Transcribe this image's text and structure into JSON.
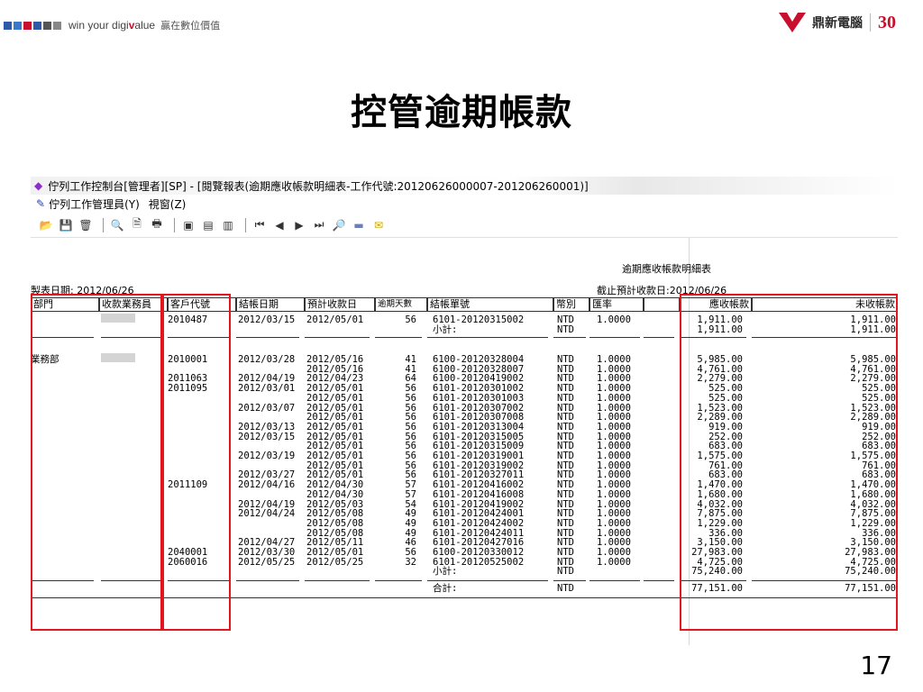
{
  "header": {
    "tagline": "win your digi",
    "tagline_v": "v",
    "tagline_end": "alue",
    "tagline_zh": "贏在數位價值",
    "brand_name": "鼎新電腦",
    "brand_30": "30",
    "colors": {
      "brand_red": "#c8102e",
      "squares": [
        "#2e5aa8",
        "#3a78c8",
        "#c8102e",
        "#2e5aa8",
        "#555555",
        "#888888"
      ]
    }
  },
  "slide_title": "控管逾期帳款",
  "app": {
    "title": "佇列工作控制台[管理者][SP] - [閱覽報表(逾期應收帳款明細表-工作代號:20120626000007-201206260001)]",
    "menu": [
      "佇列工作管理員(Y)",
      "視窗(Z)"
    ],
    "toolbar_icons": [
      "open-icon",
      "save-icon",
      "delete-icon",
      "find-icon",
      "preview-icon",
      "print-icon",
      "export-icon",
      "export-alt-icon",
      "copy-icon",
      "first-page-icon",
      "prev-page-icon",
      "next-page-icon",
      "last-page-icon",
      "zoom-icon",
      "separator-bar-icon",
      "mail-icon"
    ]
  },
  "report": {
    "name": "逾期應收帳款明細表",
    "print_date_label": "製表日期:",
    "print_date": "2012/06/26",
    "cutoff_label": "截止預計收款日:",
    "cutoff_date": "2012/06/26",
    "columns": [
      "部門",
      "收款業務員",
      "客戶代號",
      "結帳日期",
      "預計收款日",
      "逾期天數",
      "結帳單號",
      "幣別",
      "匯率",
      "",
      "應收帳款",
      "未收帳款"
    ],
    "group1": {
      "dept": "",
      "customer": "2010487",
      "rows": [
        {
          "close": "2012/03/15",
          "due": "2012/05/01",
          "days": "56",
          "doc": "6101-20120315002",
          "cur": "NTD",
          "rate": "1.0000",
          "ar": "1,911.00",
          "un": "1,911.00"
        }
      ],
      "subtotal": {
        "label": "小計:",
        "cur": "NTD",
        "ar": "1,911.00",
        "un": "1,911.00"
      }
    },
    "group2": {
      "dept": "業務部",
      "rows": [
        {
          "cust": "2010001",
          "close": "2012/03/28",
          "due": "2012/05/16",
          "days": "41",
          "doc": "6100-20120328004",
          "cur": "NTD",
          "rate": "1.0000",
          "ar": "5,985.00",
          "un": "5,985.00"
        },
        {
          "cust": "",
          "close": "",
          "due": "2012/05/16",
          "days": "41",
          "doc": "6100-20120328007",
          "cur": "NTD",
          "rate": "1.0000",
          "ar": "4,761.00",
          "un": "4,761.00"
        },
        {
          "cust": "2011063",
          "close": "2012/04/19",
          "due": "2012/04/23",
          "days": "64",
          "doc": "6100-20120419002",
          "cur": "NTD",
          "rate": "1.0000",
          "ar": "2,279.00",
          "un": "2,279.00"
        },
        {
          "cust": "2011095",
          "close": "2012/03/01",
          "due": "2012/05/01",
          "days": "56",
          "doc": "6101-20120301002",
          "cur": "NTD",
          "rate": "1.0000",
          "ar": "525.00",
          "un": "525.00"
        },
        {
          "cust": "",
          "close": "",
          "due": "2012/05/01",
          "days": "56",
          "doc": "6101-20120301003",
          "cur": "NTD",
          "rate": "1.0000",
          "ar": "525.00",
          "un": "525.00"
        },
        {
          "cust": "",
          "close": "2012/03/07",
          "due": "2012/05/01",
          "days": "56",
          "doc": "6101-20120307002",
          "cur": "NTD",
          "rate": "1.0000",
          "ar": "1,523.00",
          "un": "1,523.00"
        },
        {
          "cust": "",
          "close": "",
          "due": "2012/05/01",
          "days": "56",
          "doc": "6101-20120307008",
          "cur": "NTD",
          "rate": "1.0000",
          "ar": "2,289.00",
          "un": "2,289.00"
        },
        {
          "cust": "",
          "close": "2012/03/13",
          "due": "2012/05/01",
          "days": "56",
          "doc": "6101-20120313004",
          "cur": "NTD",
          "rate": "1.0000",
          "ar": "919.00",
          "un": "919.00"
        },
        {
          "cust": "",
          "close": "2012/03/15",
          "due": "2012/05/01",
          "days": "56",
          "doc": "6101-20120315005",
          "cur": "NTD",
          "rate": "1.0000",
          "ar": "252.00",
          "un": "252.00"
        },
        {
          "cust": "",
          "close": "",
          "due": "2012/05/01",
          "days": "56",
          "doc": "6101-20120315009",
          "cur": "NTD",
          "rate": "1.0000",
          "ar": "683.00",
          "un": "683.00"
        },
        {
          "cust": "",
          "close": "2012/03/19",
          "due": "2012/05/01",
          "days": "56",
          "doc": "6101-20120319001",
          "cur": "NTD",
          "rate": "1.0000",
          "ar": "1,575.00",
          "un": "1,575.00"
        },
        {
          "cust": "",
          "close": "",
          "due": "2012/05/01",
          "days": "56",
          "doc": "6101-20120319002",
          "cur": "NTD",
          "rate": "1.0000",
          "ar": "761.00",
          "un": "761.00"
        },
        {
          "cust": "",
          "close": "2012/03/27",
          "due": "2012/05/01",
          "days": "56",
          "doc": "6101-20120327011",
          "cur": "NTD",
          "rate": "1.0000",
          "ar": "683.00",
          "un": "683.00"
        },
        {
          "cust": "2011109",
          "close": "2012/04/16",
          "due": "2012/04/30",
          "days": "57",
          "doc": "6101-20120416002",
          "cur": "NTD",
          "rate": "1.0000",
          "ar": "1,470.00",
          "un": "1,470.00"
        },
        {
          "cust": "",
          "close": "",
          "due": "2012/04/30",
          "days": "57",
          "doc": "6101-20120416008",
          "cur": "NTD",
          "rate": "1.0000",
          "ar": "1,680.00",
          "un": "1,680.00"
        },
        {
          "cust": "",
          "close": "2012/04/19",
          "due": "2012/05/03",
          "days": "54",
          "doc": "6101-20120419002",
          "cur": "NTD",
          "rate": "1.0000",
          "ar": "4,032.00",
          "un": "4,032.00"
        },
        {
          "cust": "",
          "close": "2012/04/24",
          "due": "2012/05/08",
          "days": "49",
          "doc": "6101-20120424001",
          "cur": "NTD",
          "rate": "1.0000",
          "ar": "7,875.00",
          "un": "7,875.00"
        },
        {
          "cust": "",
          "close": "",
          "due": "2012/05/08",
          "days": "49",
          "doc": "6101-20120424002",
          "cur": "NTD",
          "rate": "1.0000",
          "ar": "1,229.00",
          "un": "1,229.00"
        },
        {
          "cust": "",
          "close": "",
          "due": "2012/05/08",
          "days": "49",
          "doc": "6101-20120424011",
          "cur": "NTD",
          "rate": "1.0000",
          "ar": "336.00",
          "un": "336.00"
        },
        {
          "cust": "",
          "close": "2012/04/27",
          "due": "2012/05/11",
          "days": "46",
          "doc": "6101-20120427016",
          "cur": "NTD",
          "rate": "1.0000",
          "ar": "3,150.00",
          "un": "3,150.00"
        },
        {
          "cust": "2040001",
          "close": "2012/03/30",
          "due": "2012/05/01",
          "days": "56",
          "doc": "6100-20120330012",
          "cur": "NTD",
          "rate": "1.0000",
          "ar": "27,983.00",
          "un": "27,983.00"
        },
        {
          "cust": "2060016",
          "close": "2012/05/25",
          "due": "2012/05/25",
          "days": "32",
          "doc": "6101-20120525002",
          "cur": "NTD",
          "rate": "1.0000",
          "ar": "4,725.00",
          "un": "4,725.00"
        }
      ],
      "subtotal": {
        "label": "小計:",
        "cur": "NTD",
        "ar": "75,240.00",
        "un": "75,240.00"
      }
    },
    "grand_total": {
      "label": "合計:",
      "cur": "NTD",
      "ar": "77,151.00",
      "un": "77,151.00"
    }
  },
  "page_number": "17"
}
